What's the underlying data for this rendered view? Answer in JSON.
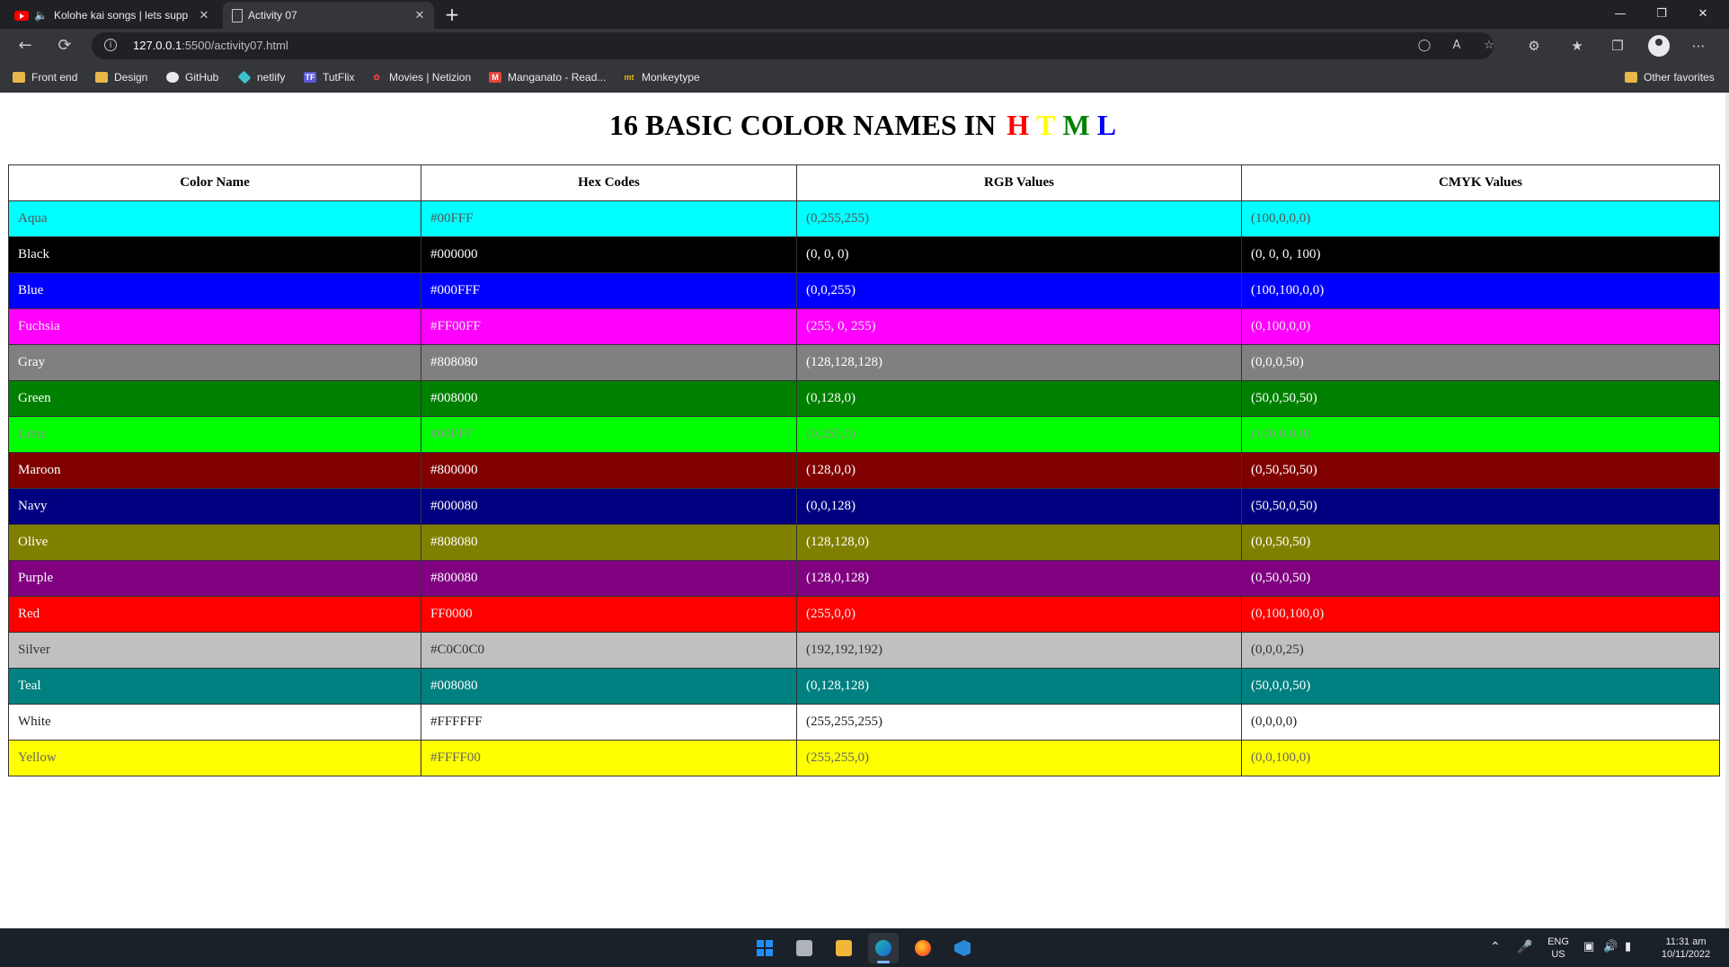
{
  "browser": {
    "tabs": [
      {
        "title": "Kolohe kai songs | lets supp",
        "icon": "youtube-icon",
        "audio": true
      },
      {
        "title": "Activity 07",
        "icon": "page-icon",
        "active": true
      }
    ],
    "url_host": "127.0.0.1",
    "url_path": ":5500/activity07.html",
    "bookmarks": [
      {
        "label": "Front end",
        "icon": "folder-icon"
      },
      {
        "label": "Design",
        "icon": "folder-icon"
      },
      {
        "label": "GitHub",
        "icon": "github-icon"
      },
      {
        "label": "netlify",
        "icon": "netlify-icon"
      },
      {
        "label": "TutFlix",
        "icon": "tutflix-icon"
      },
      {
        "label": "Movies | Netizion",
        "icon": "movies-icon"
      },
      {
        "label": "Manganato - Read...",
        "icon": "manganato-icon"
      },
      {
        "label": "Monkeytype",
        "icon": "monkeytype-icon"
      }
    ],
    "other_favorites": "Other favorites"
  },
  "page": {
    "heading_prefix": "16 BASIC COLOR NAMES IN",
    "heading_letters": [
      {
        "char": "H",
        "color": "#ff0000"
      },
      {
        "char": "T",
        "color": "#ffff00"
      },
      {
        "char": "M",
        "color": "#008000"
      },
      {
        "char": "L",
        "color": "#0000ff"
      }
    ],
    "table": {
      "headers": [
        "Color Name",
        "Hex Codes",
        "RGB Values",
        "CMYK Values"
      ],
      "rows": [
        {
          "name": "Aqua",
          "hex": "#00FFF",
          "rgb": "(0,255,255)",
          "cmyk": "(100,0,0,0)",
          "bg": "#00ffff",
          "fg": "#555555"
        },
        {
          "name": "Black",
          "hex": "#000000",
          "rgb": "(0, 0, 0)",
          "cmyk": "(0, 0, 0, 100)",
          "bg": "#000000",
          "fg": "#ffffff"
        },
        {
          "name": "Blue",
          "hex": "#000FFF",
          "rgb": "(0,0,255)",
          "cmyk": "(100,100,0,0)",
          "bg": "#0000ff",
          "fg": "#ffffff"
        },
        {
          "name": "Fuchsia",
          "hex": "#FF00FF",
          "rgb": "(255, 0, 255)",
          "cmyk": "(0,100,0,0)",
          "bg": "#ff00ff",
          "fg": "#f0f0f0"
        },
        {
          "name": "Gray",
          "hex": "#808080",
          "rgb": "(128,128,128)",
          "cmyk": "(0,0,0,50)",
          "bg": "#808080",
          "fg": "#ffffff"
        },
        {
          "name": "Green",
          "hex": "#008000",
          "rgb": "(0,128,0)",
          "cmyk": "(50,0,50,50)",
          "bg": "#008000",
          "fg": "#ffffff"
        },
        {
          "name": "Lime",
          "hex": "#00FFF",
          "rgb": "(0,255,0)",
          "cmyk": "(100,0,0,0)",
          "bg": "#00ff00",
          "fg": "#909090"
        },
        {
          "name": "Maroon",
          "hex": "#800000",
          "rgb": "(128,0,0)",
          "cmyk": "(0,50,50,50)",
          "bg": "#800000",
          "fg": "#ffffff"
        },
        {
          "name": "Navy",
          "hex": "#000080",
          "rgb": "(0,0,128)",
          "cmyk": "(50,50,0,50)",
          "bg": "#000080",
          "fg": "#ffffff"
        },
        {
          "name": "Olive",
          "hex": "#808080",
          "rgb": "(128,128,0)",
          "cmyk": "(0,0,50,50)",
          "bg": "#808000",
          "fg": "#ffffff"
        },
        {
          "name": "Purple",
          "hex": "#800080",
          "rgb": "(128,0,128)",
          "cmyk": "(0,50,0,50)",
          "bg": "#800080",
          "fg": "#ffffff"
        },
        {
          "name": "Red",
          "hex": "FF0000",
          "rgb": "(255,0,0)",
          "cmyk": "(0,100,100,0)",
          "bg": "#ff0000",
          "fg": "#f0f0f0"
        },
        {
          "name": "Silver",
          "hex": "#C0C0C0",
          "rgb": "(192,192,192)",
          "cmyk": "(0,0,0,25)",
          "bg": "#c0c0c0",
          "fg": "#333333"
        },
        {
          "name": "Teal",
          "hex": "#008080",
          "rgb": "(0,128,128)",
          "cmyk": "(50,0,0,50)",
          "bg": "#008080",
          "fg": "#ffffff"
        },
        {
          "name": "White",
          "hex": "#FFFFFF",
          "rgb": "(255,255,255)",
          "cmyk": "(0,0,0,0)",
          "bg": "#ffffff",
          "fg": "#222222"
        },
        {
          "name": "Yellow",
          "hex": "#FFFF00",
          "rgb": "(255,255,0)",
          "cmyk": "(0,0,100,0)",
          "bg": "#ffff00",
          "fg": "#666666"
        }
      ]
    }
  },
  "taskbar": {
    "apps": [
      "windows-start-icon",
      "task-view-icon",
      "file-explorer-icon",
      "edge-icon",
      "firefox-icon",
      "vscode-icon"
    ],
    "lang_top": "ENG",
    "lang_bottom": "US",
    "time": "11:31 am",
    "date": "10/11/2022"
  }
}
